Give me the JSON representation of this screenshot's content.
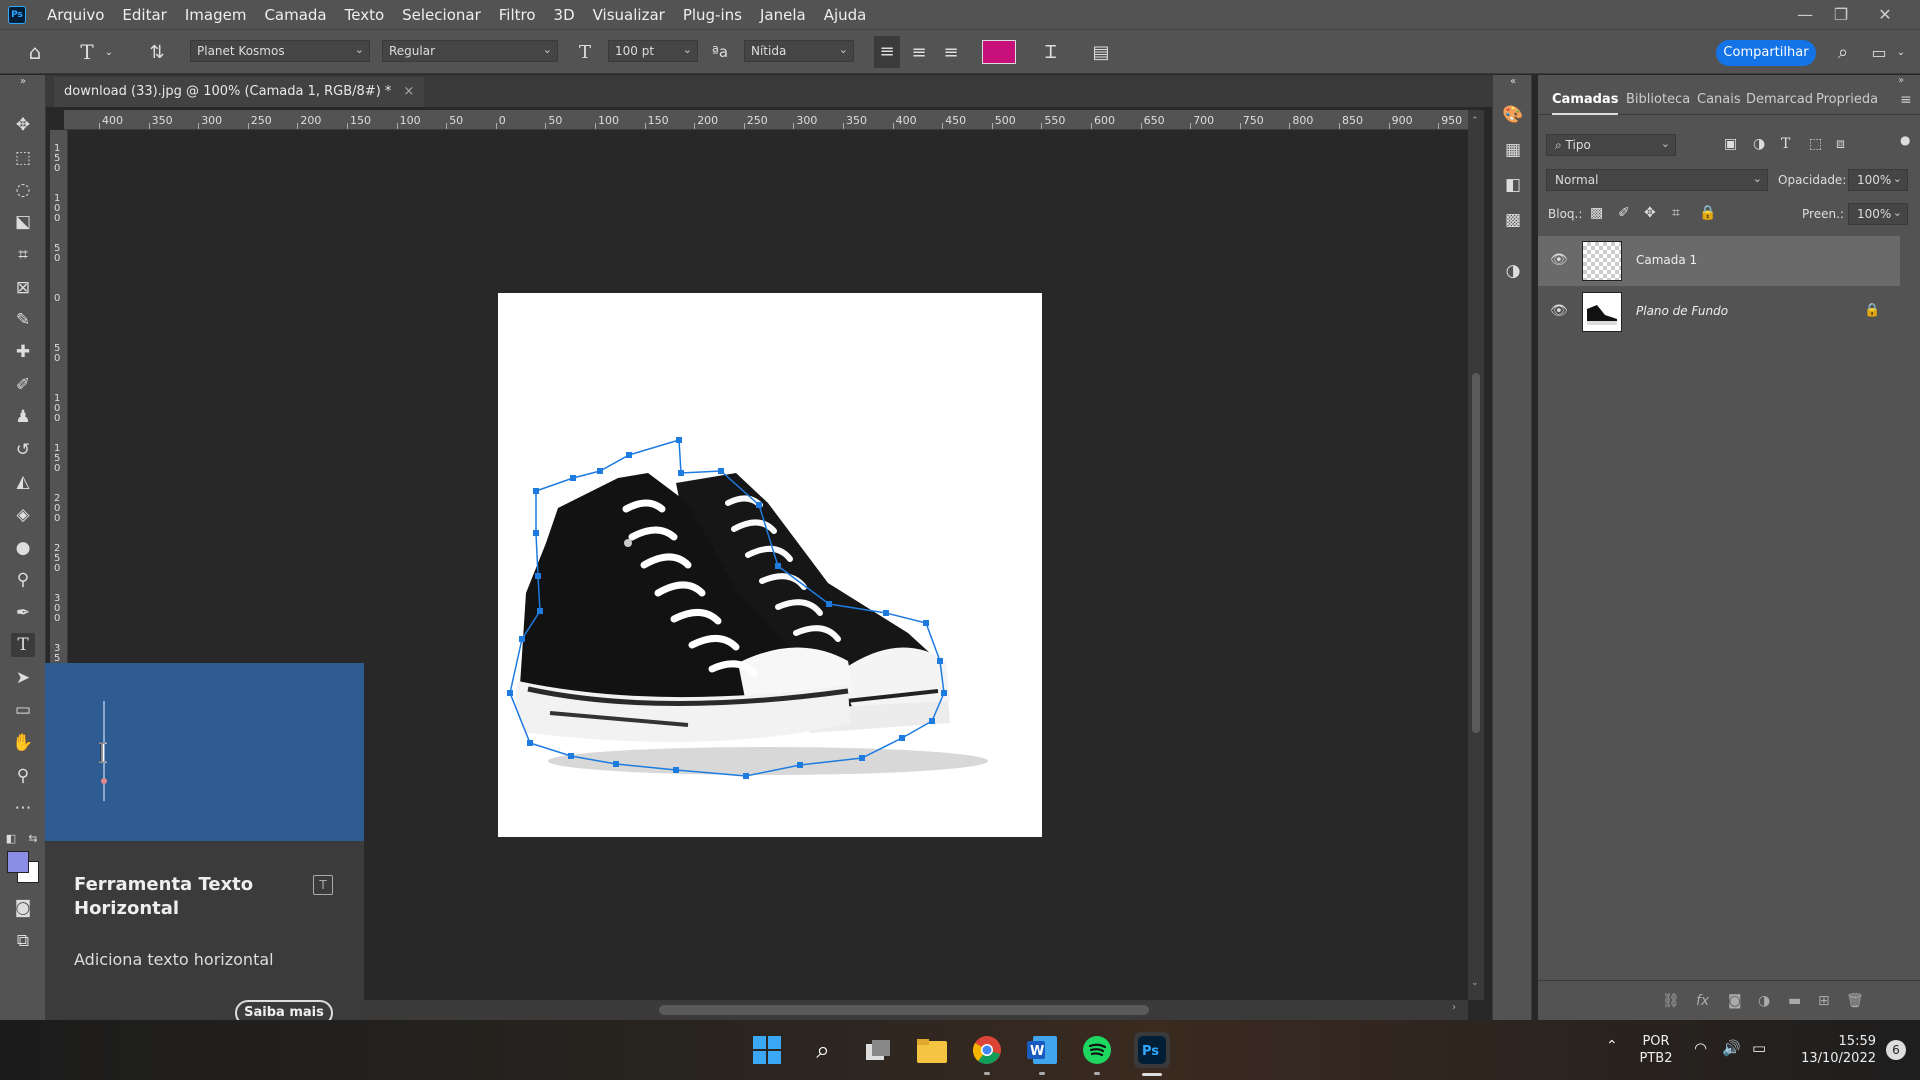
{
  "menubar": {
    "logo": "Ps",
    "items": [
      "Arquivo",
      "Editar",
      "Imagem",
      "Camada",
      "Texto",
      "Selecionar",
      "Filtro",
      "3D",
      "Visualizar",
      "Plug-ins",
      "Janela",
      "Ajuda"
    ]
  },
  "options": {
    "font_family": "Planet Kosmos",
    "font_style": "Regular",
    "font_size": "100 pt",
    "antialias_glyph": "ªa",
    "antialias": "Nítida",
    "text_color": "#c8107a",
    "share": "Compartilhar"
  },
  "document": {
    "tab_title": "download (33).jpg @ 100% (Camada 1, RGB/8#) *"
  },
  "ruler_top": [
    "400",
    "350",
    "300",
    "250",
    "200",
    "150",
    "100",
    "50",
    "0",
    "50",
    "100",
    "150",
    "200",
    "250",
    "300",
    "350",
    "400",
    "450",
    "500",
    "550",
    "600",
    "650",
    "700",
    "750",
    "800",
    "850",
    "900",
    "950"
  ],
  "ruler_left": [
    "150",
    "100",
    "50",
    "0",
    "50",
    "100",
    "150",
    "200",
    "250",
    "300",
    "350"
  ],
  "tooltip": {
    "title": "Ferramenta Texto Horizontal",
    "shortcut": "T",
    "description": "Adiciona texto horizontal",
    "learn_more": "Saiba mais"
  },
  "layers_panel": {
    "tabs": [
      "Camadas",
      "Biblioteca",
      "Canais",
      "Demarcad",
      "Proprieda"
    ],
    "filter_kind": "Tipo",
    "blend_mode": "Normal",
    "opacity_label": "Opacidade:",
    "opacity": "100%",
    "lock_label": "Bloq.:",
    "fill_label": "Preen.:",
    "fill": "100%",
    "layers": [
      {
        "name": "Camada 1",
        "selected": true
      },
      {
        "name": "Plano de Fundo",
        "locked": true
      }
    ]
  },
  "taskbar": {
    "lang_top": "POR",
    "lang_bottom": "PTB2",
    "time": "15:59",
    "date": "13/10/2022",
    "notifications": "6"
  },
  "colors": {
    "accent": "#1473e6",
    "tooltip_preview": "#2f5b93",
    "path": "#1e7be0"
  }
}
